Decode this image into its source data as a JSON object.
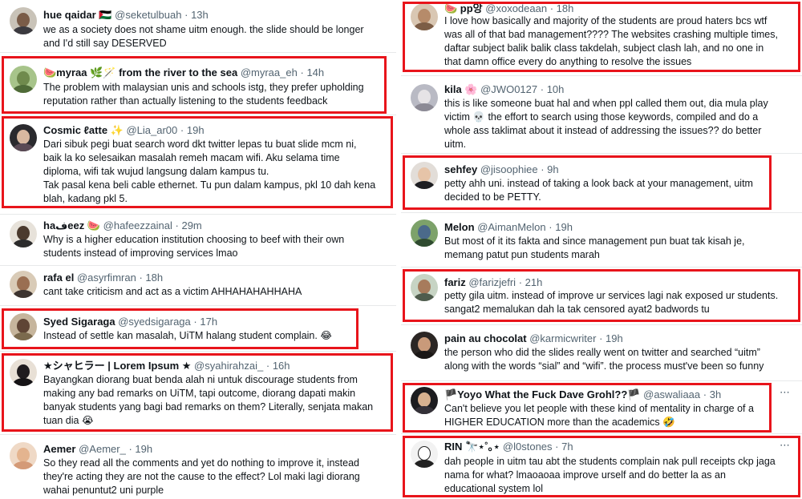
{
  "left": [
    {
      "name": "hue qaidar 🇵🇸",
      "handle": "@seketulbuah",
      "time": "13h",
      "text": "we as a society does not shame uitm enough. the slide should be longer\nand I'd still say DESERVED"
    },
    {
      "name": "🍉myraa 🌿🪄 from the river to the sea",
      "handle": "@myraa_eh",
      "time": "14h",
      "text": "The problem with malaysian unis and schools istg, they prefer upholding\nreputation rather than actually listening to the students feedback"
    },
    {
      "name": "Cosmic ℓatte ✨",
      "handle": "@Lia_ar00",
      "time": "19h",
      "text": "Dari sibuk pegi buat search word dkt twitter lepas tu buat slide mcm ni,\nbaik la ko selesaikan masalah remeh macam wifi. Aku selama time\ndiploma, wifi tak wujud langsung dalam kampus tu.\nTak pasal kena beli cable ethernet. Tu pun dalam kampus, pkl 10 dah kena\nblah, kadang pkl 5."
    },
    {
      "name": "haفeez 🍉",
      "handle": "@hafeezzainal",
      "time": "29m",
      "text": "Why is a higher education institution choosing to beef with their own\nstudents instead of improving services lmao"
    },
    {
      "name": "rafa el",
      "handle": "@asyrfimran",
      "time": "18h",
      "text": "cant take criticism and act as a victim AHHAHAHAHHAHA"
    },
    {
      "name": "Syed Sigaraga",
      "handle": "@syedsigaraga",
      "time": "17h",
      "text": "Instead of settle kan masalah, UiTM halang student complain. 😂"
    },
    {
      "name": "★シャヒラー | Lorem Ipsum ★",
      "handle": "@syahirahzai_",
      "time": "16h",
      "text": "Bayangkan diorang buat benda alah ni untuk discourage students from\nmaking any bad remarks on UiTM, tapi outcome, diorang dapati makin\nbanyak students yang bagi bad remarks on them? Literally, senjata makan\ntuan dia 😭"
    },
    {
      "name": "Aemer",
      "handle": "@Aemer_",
      "time": "19h",
      "text": "So they read all the comments and yet do nothing to improve it, instead\nthey're acting they are not the cause to the effect? Lol maki lagi diorang\nwahai penuntut2 uni purple"
    }
  ],
  "right": [
    {
      "name": "🍉 pp앙",
      "handle": "@xoxodeaan",
      "time": "18h",
      "text": "I love how basically and majority of the students are proud haters bcs wtf\nwas all of that bad management???? The websites crashing multiple times,\ndaftar subject balik balik class takdelah, subject clash lah, and no one in\nthat damn office every do anything to resolve the issues"
    },
    {
      "name": "kila 🌸",
      "handle": "@JWO0127",
      "time": "10h",
      "text": "this is like someone buat hal and when ppl called them out, dia mula play\nvictim 💀 the effort to search using those keywords, compiled and do a\nwhole ass taklimat about it instead of addressing the issues?? do better\nuitm."
    },
    {
      "name": "sehfey",
      "handle": "@jisoophiee",
      "time": "9h",
      "text": "petty ahh uni. instead of taking a look back at your management, uitm\ndecided to be PETTY."
    },
    {
      "name": "Melon",
      "handle": "@AimanMelon",
      "time": "19h",
      "text": "But most of it its fakta and since management pun buat tak kisah je,\nmemang patut pun students marah"
    },
    {
      "name": "fariz",
      "handle": "@farizjefri",
      "time": "21h",
      "text": "petty gila uitm. instead of improve ur services lagi nak exposed ur students.\nsangat2 memalukan dah la tak censored ayat2 badwords tu"
    },
    {
      "name": "pain au chocolat",
      "handle": "@karmicwriter",
      "time": "19h",
      "text": "the person who did the slides really went on twitter and searched “uitm”\nalong with the words “sial” and “wifi”. the process must've been so funny"
    },
    {
      "name": "🏴Yoyo What the Fuck Dave Grohl??🏴",
      "handle": "@aswaliaaa",
      "time": "3h",
      "text": "Can't believe you let people with these kind of mentality in charge of a\nHIGHER EDUCATION more than the academics 🤣"
    },
    {
      "name": "RIN 🔭⋆˚｡⋆",
      "handle": "@l0stones",
      "time": "7h",
      "text": "dah people in uitm tau abt the students complain nak pull receipts ckp jaga\nnama  for what? lmaoaoaa improve urself and do better la as an\neducational system lol"
    }
  ],
  "more_icon": "⋯",
  "separator": "·",
  "colors": {
    "highlight": "#e8141b",
    "secondary_text": "#536471",
    "divider": "#e7e9ea"
  }
}
